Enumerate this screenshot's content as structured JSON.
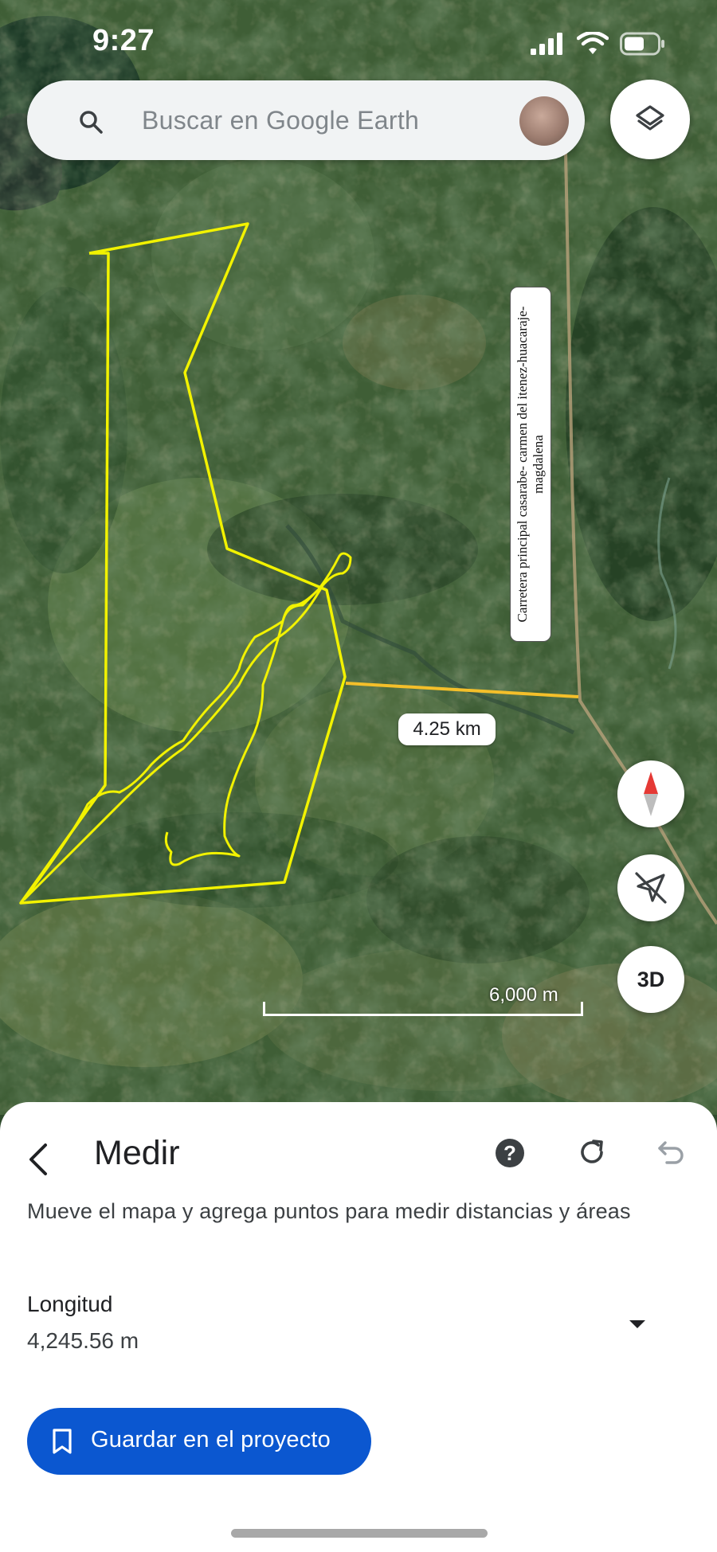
{
  "status_bar": {
    "time": "9:27",
    "icons": [
      "cellular-signal-icon",
      "wifi-icon",
      "battery-icon"
    ]
  },
  "search": {
    "placeholder": "Buscar en Google Earth",
    "icon": "search-icon"
  },
  "map": {
    "road_label": "Carretera principal casarabe- carmen del itenez-huacaraje-magdalena",
    "measurement_label": "4.25 km",
    "scale_label": "6,000 m",
    "three_d_label": "3D",
    "boundary_color": "#f2f200",
    "measure_line_color": "#f4bf2a"
  },
  "sheet": {
    "title": "Medir",
    "description": "Mueve el mapa y agrega puntos para medir distancias y áreas",
    "help_label": "?",
    "length_title": "Longitud",
    "length_value": "4,245.56 m",
    "save_label": "Guardar en el proyecto",
    "accent_color": "#0b57d0"
  }
}
